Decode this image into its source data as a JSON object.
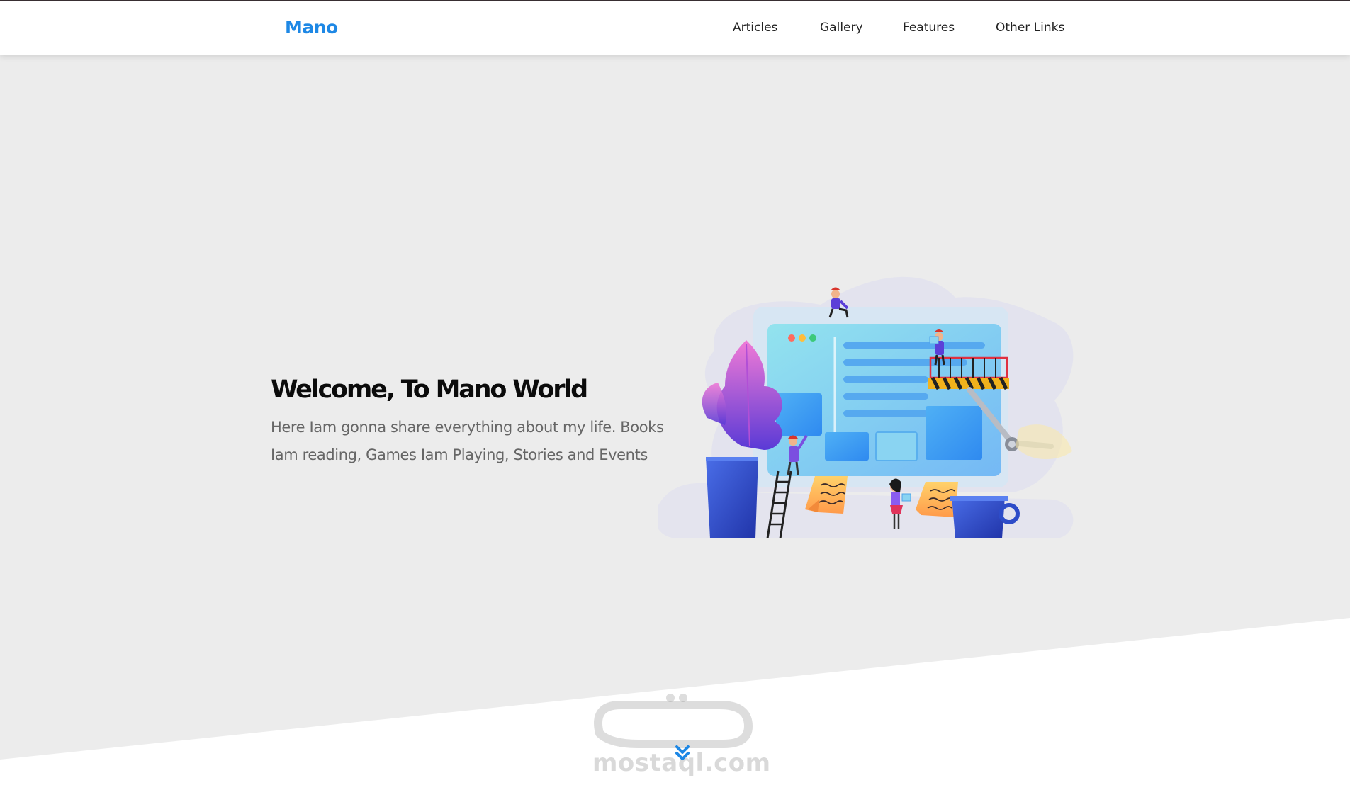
{
  "header": {
    "logo": "Mano",
    "nav": [
      {
        "label": "Articles"
      },
      {
        "label": "Gallery"
      },
      {
        "label": "Features"
      },
      {
        "label": "Other Links"
      }
    ]
  },
  "hero": {
    "title": "Welcome, To Mano World",
    "description": "Here Iam gonna share everything about my life. Books Iam reading, Games Iam Playing, Stories and Events"
  },
  "watermark": {
    "latin": "mostaql.com"
  },
  "colors": {
    "accent": "#1e88e5",
    "background": "#ececec",
    "header_bg": "#ffffff"
  },
  "icons": {
    "scroll": "double-chevron-down-icon"
  }
}
